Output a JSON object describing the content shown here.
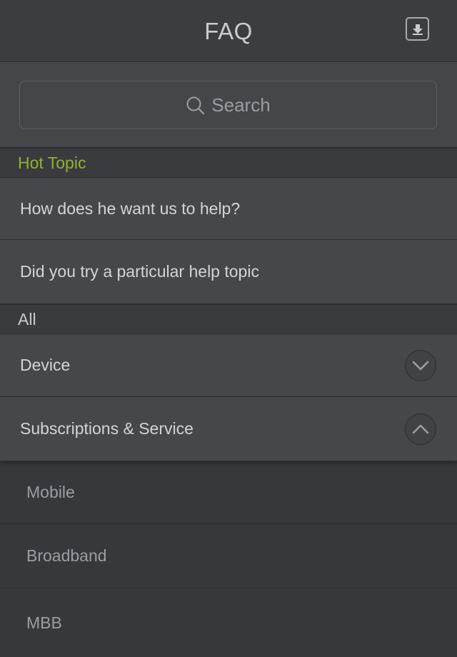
{
  "header": {
    "title": "FAQ",
    "download_icon": "download-icon"
  },
  "search": {
    "placeholder": "Search",
    "icon": "search-icon"
  },
  "hot_topic": {
    "label": "Hot Topic",
    "items": [
      {
        "label": "How does he want us to help?"
      },
      {
        "label": "Did you try  a particular help topic"
      }
    ]
  },
  "all": {
    "label": "All",
    "categories": [
      {
        "label": "Device",
        "icon": "chevron-down-icon",
        "expanded": false
      },
      {
        "label": "Subscriptions & Service",
        "icon": "chevron-up-icon",
        "expanded": true,
        "children": [
          {
            "label": "Mobile"
          },
          {
            "label": "Broadband"
          },
          {
            "label": "MBB"
          }
        ]
      }
    ]
  },
  "colors": {
    "accent": "#8fb32e",
    "background": "#3c3e42"
  }
}
